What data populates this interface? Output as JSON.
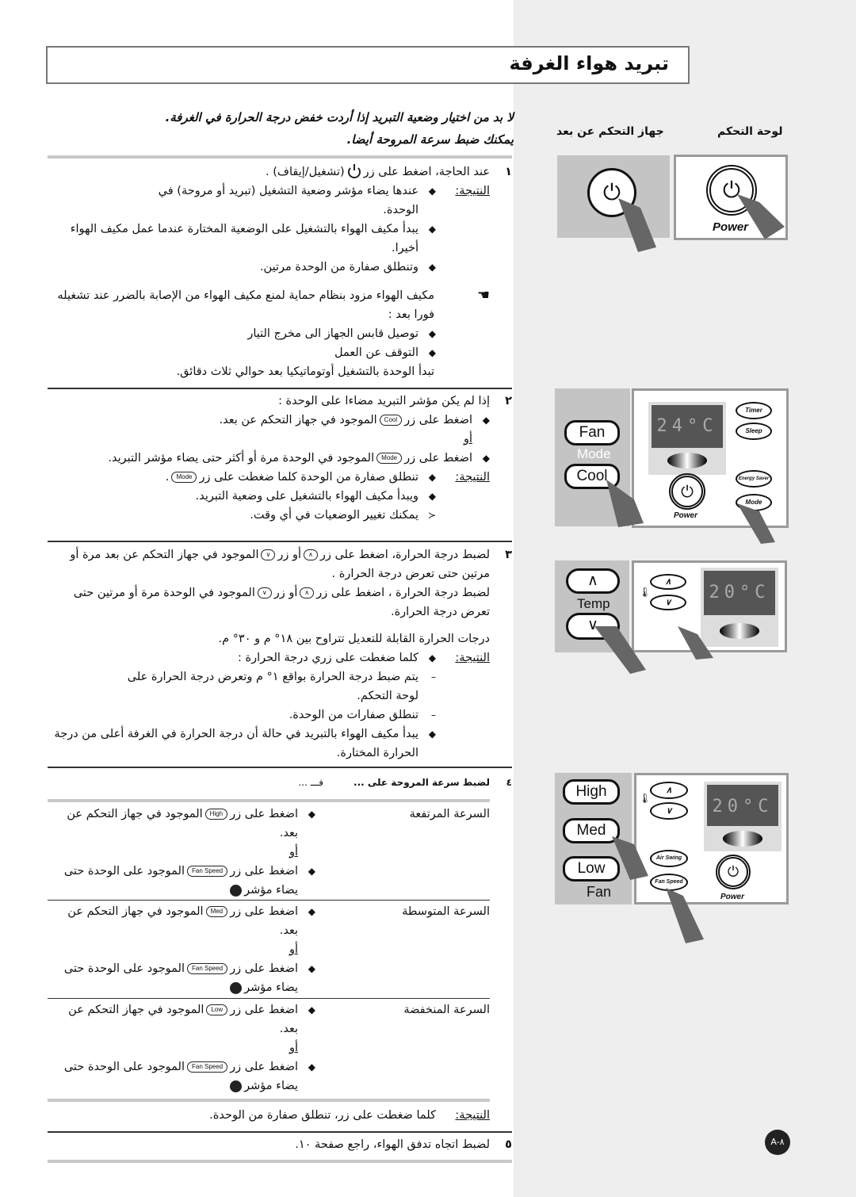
{
  "title": "تبريد هواء الغرفة",
  "intro": [
    "لا بد من اختيار وضعية التبريد إذا أردت خفض درجة الحرارة في الغرفة.",
    "يمكنك ضبط سرعة المروحة أيضا."
  ],
  "result_label": "النتيجة:",
  "or": "أو",
  "s1": {
    "num": "١",
    "line_a": "عند الحاجة، اضغط على زر",
    "line_b": "(تشغيل/إيقاف) .",
    "results": [
      "عندها يضاء مؤشر وضعية التشغيل (تبريد أو مروحة) في الوحدة.",
      "يبدأ مكيف الهواء بالتشغيل على الوضعية المختارة عندما عمل مكيف الهواء أخيرا.",
      "وتنطلق صفارة من الوحدة مرتين."
    ],
    "note": "مكيف الهواء مزود بنظام حماية لمنع مكيف الهواء من الإصابة بالضرر عند تشغيله فورا بعد :",
    "note_items": [
      "توصيل قابس الجهاز الى مخرج التيار",
      "التوقف عن العمل"
    ],
    "note_end": "تبدأ الوحدة بالتشغيل أوتوماتيكيا بعد حوالي ثلاث دقائق."
  },
  "s2": {
    "num": "٢",
    "line": "إذا لم يكن مؤشر التبريد مضاءا على الوحدة :",
    "b1_a": "اضغط على زر",
    "b1_btn": "Cool",
    "b1_b": "الموجود في جهاز التحكم عن بعد.",
    "b2_a": "اضغط على زر",
    "b2_btn": "Mode",
    "b2_b": "الموجود في الوحدة مرة أو أكثر حتى يضاء مؤشر التبريد.",
    "r1_a": "تنطلق صفارة من الوحدة كلما ضغطت على زر",
    "r1_btn": "Mode",
    "r1_b": ".",
    "r2": "ويبدأ مكيف الهواء بالتشغيل على وضعية التبريد.",
    "tip": "يمكنك تغيير الوضعيات في أي وقت."
  },
  "s3": {
    "num": "٣",
    "a1": "لضبط درجة الحرارة، اضغط على زر",
    "up": "∧",
    "a2": "أو زر",
    "down": "∨",
    "a3": "الموجود في جهاز التحكم عن بعد مرة أو مرتين حتى تعرض درجة الحرارة .",
    "b1": "لضبط درجة الحرارة ، اضغط على زر",
    "b2": "أو زر",
    "b3": "الموجود في الوحدة مرة أو مرتين حتى تعرض درجة الحرارة.",
    "range": "درجات الحرارة القابلة للتعديل تتراوح بين ١٨° م و ٣٠° م.",
    "r1": "كلما ضغطت على زري درجة الحرارة :",
    "d1": "يتم ضبط درجة الحرارة بواقع ١° م وتعرض درجة الحرارة على لوحة التحكم.",
    "d2": "تنطلق صفارات من الوحدة.",
    "r2": "يبدأ مكيف الهواء بالتبريد في حالة أن درجة الحرارة في الغرفة أعلى من درجة الحرارة المختارة."
  },
  "s4": {
    "num": "٤",
    "head": "لضبط سرعة المروحة على ...",
    "head2": "فـــ ...",
    "rows": [
      {
        "label": "السرعة المرتفعة",
        "btn": "High"
      },
      {
        "label": "السرعة المتوسطة",
        "btn": "Med"
      },
      {
        "label": "السرعة المنخفضة",
        "btn": "Low"
      }
    ],
    "press": "اضغط على زر",
    "remote": "الموجود في جهاز التحكم عن بعد.",
    "unit_btn": "Fan Speed",
    "unit": "الموجود على الوحدة حتى يضاء مؤشر",
    "result": "كلما ضغطت على زر، تنطلق صفارة من الوحدة."
  },
  "s5": {
    "num": "٥",
    "text": "لضبط اتجاه تدفق الهواء، راجع صفحة ١٠."
  },
  "side": {
    "unit_panel": "لوحة التحكم",
    "remote": "جهاز التحكم عن بعد",
    "power": "Power",
    "fan": "Fan",
    "mode": "Mode",
    "cool": "Cool",
    "timer": "Timer",
    "sleep": "Sleep",
    "energy": "Energy Saver",
    "unit_mode": "Mode",
    "disp1": "24°C",
    "disp2": "20°C",
    "temp": "Temp",
    "up": "∧",
    "down": "∨",
    "high": "High",
    "med": "Med",
    "low": "Low",
    "air_swing": "Air Swing",
    "fan_speed": "Fan Speed"
  },
  "page": "A-٨",
  "colors": {
    "sidebar": "#eeeeee",
    "panel_gray": "#c4c4c4",
    "pointer": "#666666"
  }
}
